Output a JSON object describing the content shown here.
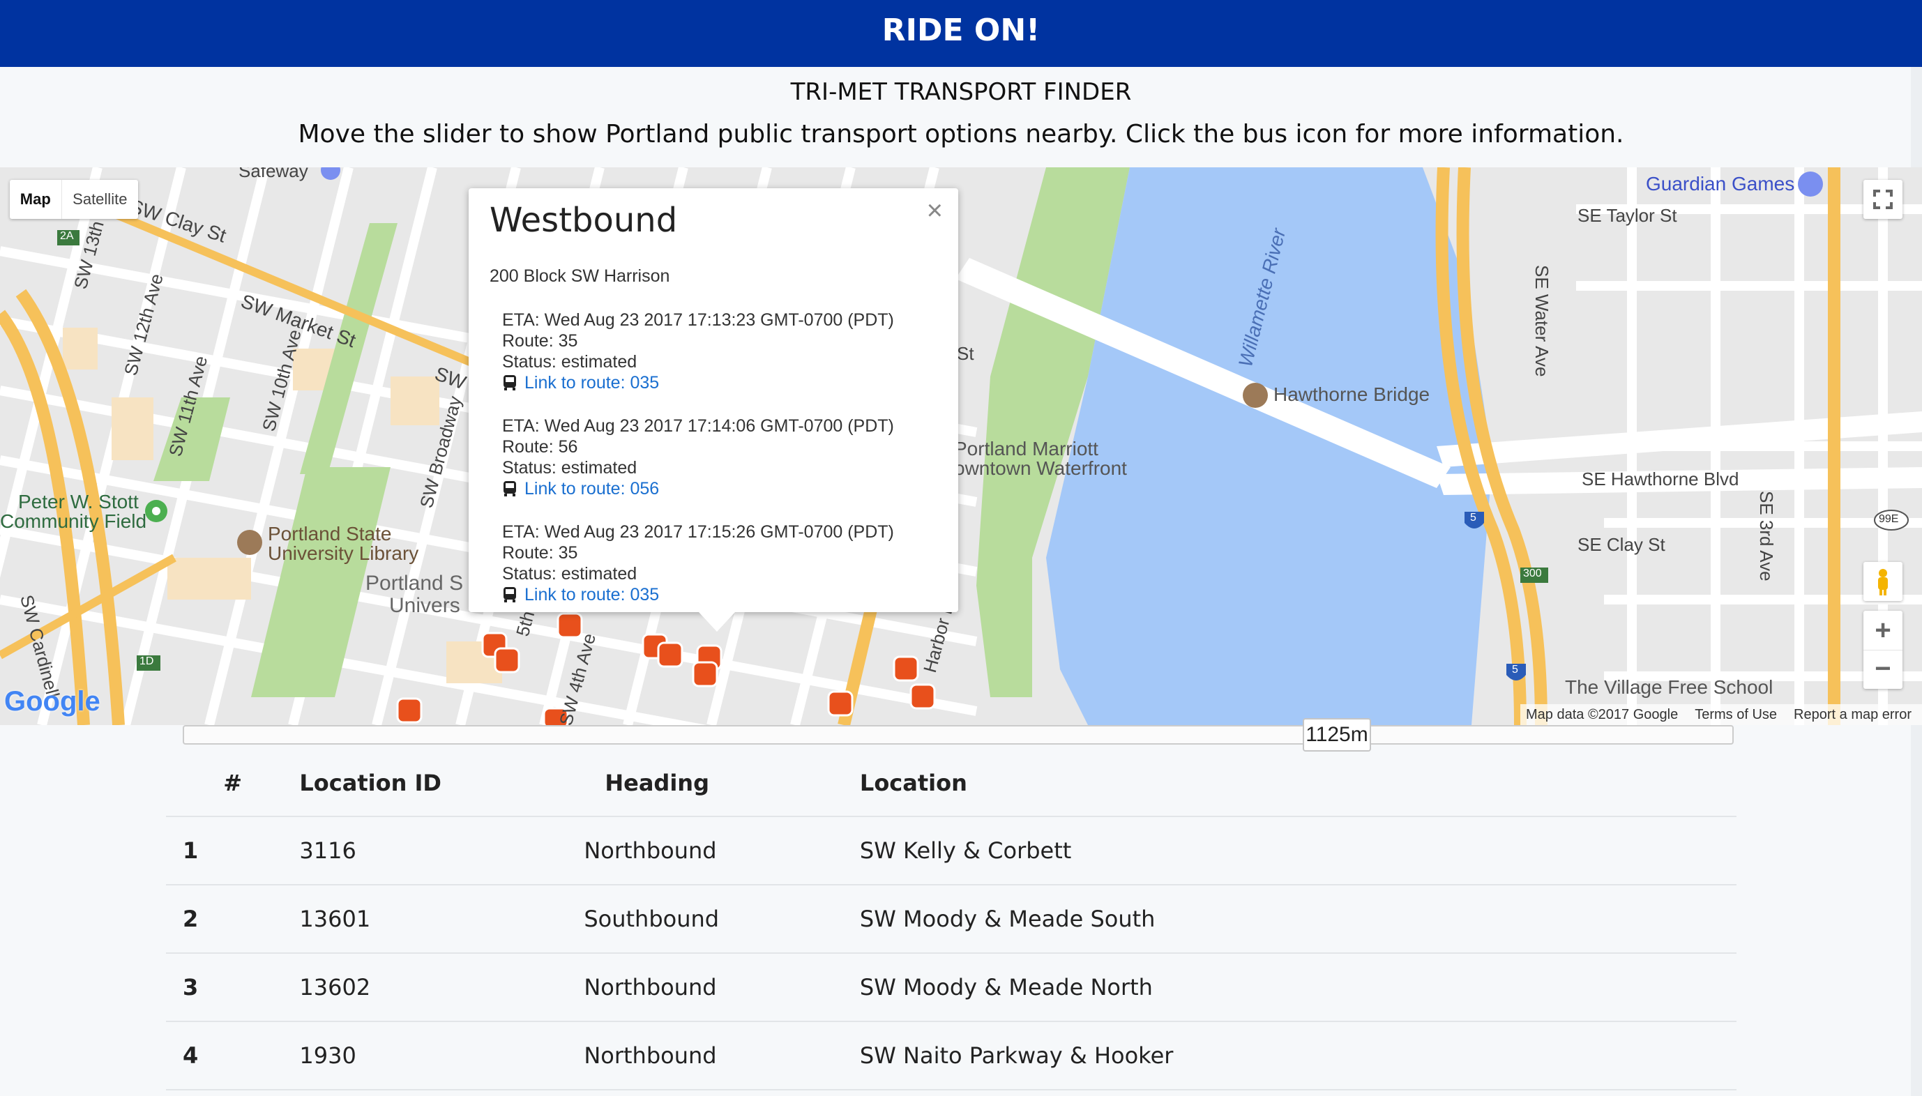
{
  "header": {
    "title": "RIDE ON!"
  },
  "subtitle": "TRI-MET TRANSPORT FINDER",
  "instructions": "Move the slider to show Portland public transport options nearby. Click the bus icon for more information.",
  "map": {
    "map_type_button": "Map",
    "satellite_button": "Satellite",
    "zoom_in": "+",
    "zoom_out": "−",
    "attribution": "Map data ©2017 Google",
    "terms": "Terms of Use",
    "report": "Report a map error",
    "google_logo": "Google",
    "labels": {
      "safeway": "Safeway",
      "sw_clay_st": "SW Clay St",
      "sw_market_st": "SW Market St",
      "sw_short": "SW",
      "sw_13th": "SW 13th",
      "sw_12th_ave": "SW 12th Ave",
      "sw_11th_ave": "SW 11th Ave",
      "sw_10th_ave": "SW 10th Ave",
      "sw_broadway": "SW Broadway",
      "sw_4th_ave": "SW 4th Ave",
      "sw_5th": "5th",
      "sw_cardinell": "SW Cardinell",
      "stott_1": "Peter W. Stott",
      "stott_2": "Community Field",
      "psu_lib_1": "Portland State",
      "psu_lib_2": "University Library",
      "psu_1": "Portland S",
      "psu_2": "Univers",
      "marriott_1": "Portland Marriott",
      "marriott_2": "owntown Waterfront",
      "willamette": "Willamette River",
      "hawthorne_bridge": "Hawthorne Bridge",
      "guardian_games": "Guardian Games",
      "se_taylor": "SE Taylor St",
      "se_water": "SE Water Ave",
      "se_hawthorne": "SE Hawthorne Blvd",
      "se_clay": "SE Clay St",
      "se_3rd": "SE 3rd Ave",
      "village_school": "The Village Free School",
      "harbor_dr": "Harbor Dr",
      "shield_2a": "2A",
      "shield_1d": "1D",
      "shield_5a": "5",
      "shield_5b": "5",
      "shield_300": "300",
      "shield_99e": "99E",
      "street_st": "St"
    },
    "colors": {
      "water": "#a4c8f8",
      "park": "#b8dc9c",
      "freeway": "#f6c15a",
      "bus_marker": "#e8501c"
    }
  },
  "popup": {
    "title": "Westbound",
    "address": "200 Block SW Harrison",
    "close_label": "×",
    "arrivals": [
      {
        "eta": "ETA: Wed Aug 23 2017 17:13:23 GMT-0700 (PDT)",
        "route": "Route: 35",
        "status": "Status: estimated",
        "link": "Link to route: 035"
      },
      {
        "eta": "ETA: Wed Aug 23 2017 17:14:06 GMT-0700 (PDT)",
        "route": "Route: 56",
        "status": "Status: estimated",
        "link": "Link to route: 056"
      },
      {
        "eta": "ETA: Wed Aug 23 2017 17:15:26 GMT-0700 (PDT)",
        "route": "Route: 35",
        "status": "Status: estimated",
        "link": "Link to route: 035"
      }
    ]
  },
  "slider": {
    "value_label": "1125m"
  },
  "table": {
    "headers": [
      "#",
      "Location ID",
      "Heading",
      "Location"
    ],
    "rows": [
      {
        "num": "1",
        "id": "3116",
        "heading": "Northbound",
        "location": "SW Kelly & Corbett"
      },
      {
        "num": "2",
        "id": "13601",
        "heading": "Southbound",
        "location": "SW Moody & Meade South"
      },
      {
        "num": "3",
        "id": "13602",
        "heading": "Northbound",
        "location": "SW Moody & Meade North"
      },
      {
        "num": "4",
        "id": "1930",
        "heading": "Northbound",
        "location": "SW Naito Parkway & Hooker"
      }
    ]
  }
}
